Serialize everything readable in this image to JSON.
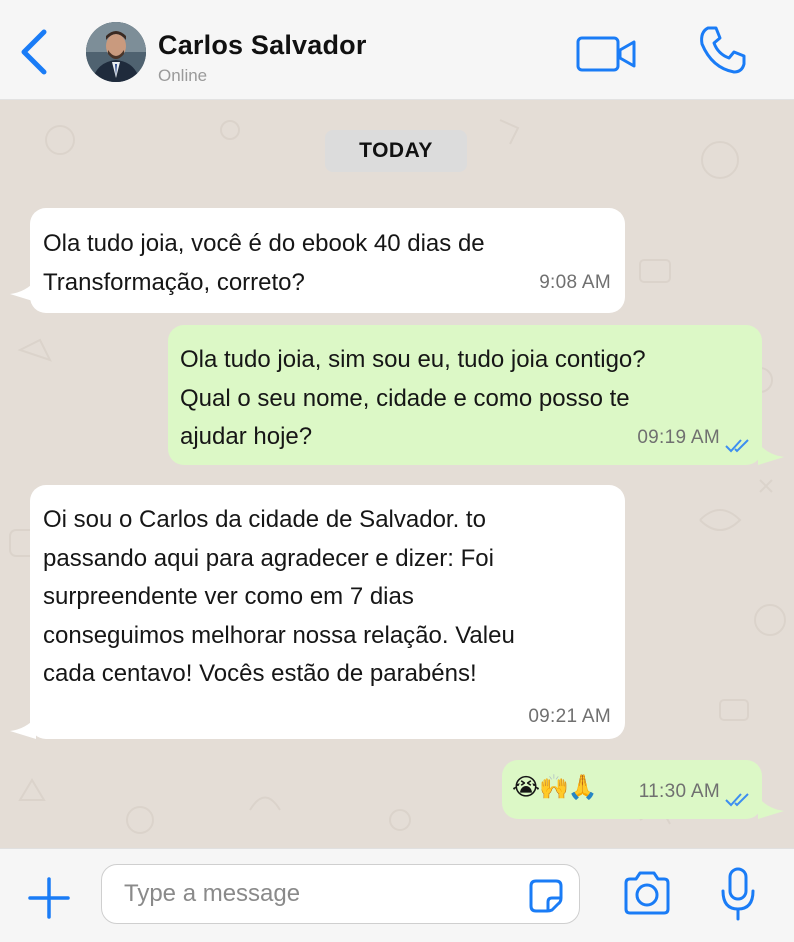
{
  "header": {
    "contact_name": "Carlos Salvador",
    "status": "Online"
  },
  "chat": {
    "date_divider": "TODAY",
    "messages": [
      {
        "direction": "incoming",
        "lines": [
          "Ola tudo joia, você é do ebook 40 dias de",
          "Transformação, correto?"
        ],
        "time": "9:08 AM"
      },
      {
        "direction": "outgoing",
        "lines": [
          "Ola tudo joia, sim sou eu, tudo joia contigo?",
          "Qual o seu nome, cidade e como posso te",
          "ajudar hoje?"
        ],
        "time": "09:19 AM",
        "read_receipt": "double-check-icon"
      },
      {
        "direction": "incoming",
        "lines": [
          "Oi sou o Carlos da cidade de Salvador. to",
          "passando aqui para agradecer e dizer: Foi",
          "surpreendente ver como em 7 dias",
          "conseguimos melhorar nossa relação. Valeu",
          "cada centavo! Vocês estão de parabéns!"
        ],
        "time": "09:21 AM"
      },
      {
        "direction": "outgoing",
        "emoji": "😭🙌🙏",
        "time": "11:30 AM",
        "read_receipt": "double-check-icon"
      }
    ]
  },
  "composer": {
    "placeholder": "Type a message"
  },
  "colors": {
    "accent": "#1a7cf6",
    "incoming_bubble": "#ffffff",
    "outgoing_bubble": "#dcf8c6",
    "wallpaper": "#e4ddd6",
    "read_tick": "#3d8ef0"
  }
}
